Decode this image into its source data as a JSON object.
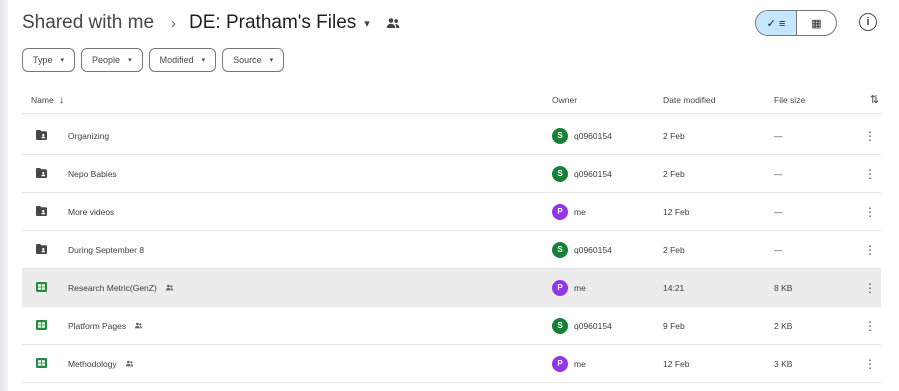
{
  "breadcrumb": {
    "root": "Shared with me",
    "separator": "›",
    "current": "DE: Pratham's Files",
    "caret": "▾"
  },
  "view_toggle": {
    "list_label": "✓ ≡",
    "grid_label": "▦"
  },
  "info_label": "i",
  "filters": [
    {
      "label": "Type"
    },
    {
      "label": "People"
    },
    {
      "label": "Modified"
    },
    {
      "label": "Source"
    }
  ],
  "columns": {
    "name": "Name",
    "owner": "Owner",
    "date_modified": "Date modified",
    "file_size": "File size"
  },
  "colors": {
    "folder": "#444746",
    "sheet": "#1e8e3e",
    "owner_green": "#188038",
    "owner_purple": "#9334e6",
    "selected_row": "#ececec"
  },
  "rows": [
    {
      "name": "Organizing",
      "type": "folder",
      "shared": false,
      "owner": "q0960154",
      "avatar": "S",
      "avatar_color": "#188038",
      "date": "2 Feb",
      "size": "—"
    },
    {
      "name": "Nepo Babies",
      "type": "folder",
      "shared": false,
      "owner": "q0960154",
      "avatar": "S",
      "avatar_color": "#188038",
      "date": "2 Feb",
      "size": "—"
    },
    {
      "name": "More videos",
      "type": "folder",
      "shared": false,
      "owner": "me",
      "avatar": "P",
      "avatar_color": "#9334e6",
      "date": "12 Feb",
      "size": "—"
    },
    {
      "name": "During September 8",
      "type": "folder",
      "shared": false,
      "owner": "q0960154",
      "avatar": "S",
      "avatar_color": "#188038",
      "date": "2 Feb",
      "size": "—"
    },
    {
      "name": "Research Metric(GenZ)",
      "type": "sheet",
      "shared": true,
      "owner": "me",
      "avatar": "P",
      "avatar_color": "#9334e6",
      "date": "14:21",
      "size": "8 KB",
      "selected": true
    },
    {
      "name": "Platform Pages",
      "type": "sheet",
      "shared": true,
      "owner": "q0960154",
      "avatar": "S",
      "avatar_color": "#188038",
      "date": "9 Feb",
      "size": "2 KB"
    },
    {
      "name": "Methodology",
      "type": "sheet",
      "shared": true,
      "owner": "me",
      "avatar": "P",
      "avatar_color": "#9334e6",
      "date": "12 Feb",
      "size": "3 KB"
    }
  ],
  "more_icon": "⋮"
}
